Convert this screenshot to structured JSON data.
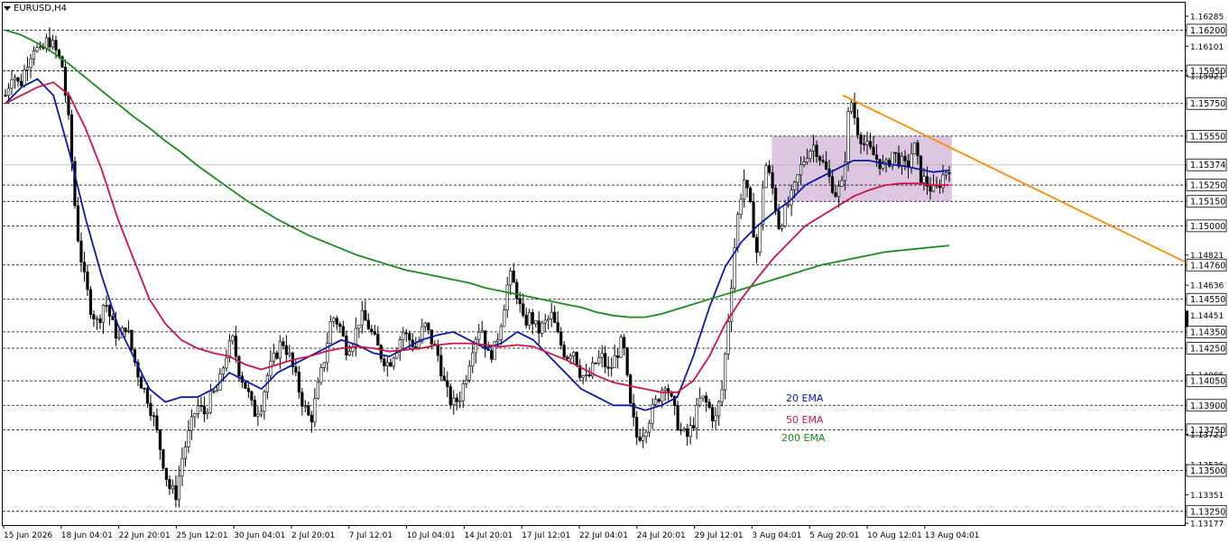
{
  "window": {
    "symbol_title": "EURUSD,H4"
  },
  "chart_data": {
    "type": "candlestick",
    "title": "EURUSD,H4",
    "ylim": [
      1.13177,
      1.16285
    ],
    "y_tick_labels": [
      "1.16285",
      "1.16200",
      "1.16101",
      "1.15950",
      "1.15921",
      "1.15750",
      "1.15550",
      "1.15374",
      "1.15250",
      "1.15150",
      "1.15000",
      "1.14821",
      "1.14760",
      "1.14636",
      "1.14550",
      "1.14451",
      "1.14350",
      "1.14250",
      "1.14086",
      "1.14050",
      "1.13900",
      "1.13750",
      "1.13721",
      "1.13536",
      "1.13500",
      "1.13351",
      "1.13250",
      "1.13177"
    ],
    "x_tick_labels": [
      "15 Jun 2026",
      "18 Jun 04:01",
      "22 Jun 20:01",
      "25 Jun 12:01",
      "30 Jun 04:01",
      "2 Jul 20:01",
      "7 Jul 12:01",
      "10 Jul 04:01",
      "14 Jul 20:01",
      "17 Jul 12:01",
      "22 Jul 04:01",
      "24 Jul 20:01",
      "29 Jul 12:01",
      "3 Aug 04:01",
      "5 Aug 20:01",
      "10 Aug 12:01",
      "13 Aug 04:01"
    ],
    "horizontal_levels": [
      1.162,
      1.1595,
      1.1575,
      1.1555,
      1.1525,
      1.1515,
      1.15,
      1.1476,
      1.1455,
      1.1435,
      1.1425,
      1.1405,
      1.139,
      1.1375,
      1.135,
      1.1325
    ],
    "current_price": 1.15374,
    "consolidation_zone": {
      "from": "3 Aug 04:01",
      "to": "13 Aug 04:01",
      "high": 1.1555,
      "low": 1.1515
    },
    "trendline": {
      "start": {
        "time": "5 Aug 20:01",
        "price": 1.158
      },
      "end": {
        "time": "beyond 13 Aug 04:01",
        "price": 1.1478
      }
    },
    "price_path": [
      1.158,
      1.1595,
      1.1585,
      1.16,
      1.161,
      1.1605,
      1.1615,
      1.1608,
      1.1598,
      1.156,
      1.15,
      1.147,
      1.145,
      1.144,
      1.1455,
      1.144,
      1.143,
      1.144,
      1.142,
      1.1405,
      1.1395,
      1.138,
      1.136,
      1.134,
      1.1335,
      1.136,
      1.1375,
      1.139,
      1.1385,
      1.1395,
      1.14,
      1.142,
      1.143,
      1.141,
      1.14,
      1.1385,
      1.139,
      1.141,
      1.142,
      1.143,
      1.142,
      1.1405,
      1.139,
      1.138,
      1.14,
      1.142,
      1.1445,
      1.144,
      1.1425,
      1.143,
      1.1445,
      1.144,
      1.143,
      1.142,
      1.1415,
      1.1425,
      1.1435,
      1.143,
      1.1425,
      1.144,
      1.143,
      1.142,
      1.14,
      1.139,
      1.1395,
      1.141,
      1.143,
      1.144,
      1.142,
      1.1425,
      1.1445,
      1.147,
      1.146,
      1.144,
      1.1445,
      1.1435,
      1.144,
      1.1445,
      1.143,
      1.142,
      1.1425,
      1.141,
      1.1405,
      1.1415,
      1.142,
      1.141,
      1.142,
      1.143,
      1.139,
      1.137,
      1.1375,
      1.1385,
      1.1395,
      1.1405,
      1.139,
      1.1375,
      1.137,
      1.138,
      1.1395,
      1.139,
      1.138,
      1.14,
      1.145,
      1.15,
      1.153,
      1.151,
      1.148,
      1.154,
      1.1525,
      1.15,
      1.151,
      1.152,
      1.1535,
      1.1545,
      1.155,
      1.154,
      1.153,
      1.152,
      1.1525,
      1.158,
      1.156,
      1.155,
      1.1545,
      1.154,
      1.1535,
      1.1545,
      1.154,
      1.1535,
      1.155,
      1.153,
      1.1525,
      1.152,
      1.153,
      1.1537
    ],
    "series": [
      {
        "name": "20 EMA",
        "color": "#0a18a8",
        "values": [
          1.1575,
          1.1585,
          1.159,
          1.158,
          1.1545,
          1.1505,
          1.147,
          1.144,
          1.142,
          1.14,
          1.1392,
          1.1395,
          1.1395,
          1.14,
          1.141,
          1.1405,
          1.14,
          1.141,
          1.1415,
          1.142,
          1.1425,
          1.143,
          1.1427,
          1.1422,
          1.142,
          1.1425,
          1.143,
          1.1433,
          1.1435,
          1.143,
          1.1425,
          1.1428,
          1.1435,
          1.143,
          1.142,
          1.141,
          1.14,
          1.1395,
          1.139,
          1.139,
          1.1387,
          1.139,
          1.1395,
          1.142,
          1.145,
          1.1475,
          1.149,
          1.15,
          1.1508,
          1.1515,
          1.1525,
          1.153,
          1.1535,
          1.154,
          1.154,
          1.1538,
          1.1537,
          1.1535,
          1.1533,
          1.1534
        ]
      },
      {
        "name": "50 EMA",
        "color": "#cc1445",
        "values": [
          1.1575,
          1.158,
          1.1585,
          1.1588,
          1.158,
          1.156,
          1.1535,
          1.1505,
          1.148,
          1.1455,
          1.144,
          1.143,
          1.1425,
          1.1422,
          1.142,
          1.1415,
          1.1412,
          1.1415,
          1.1418,
          1.142,
          1.1423,
          1.1425,
          1.1426,
          1.1425,
          1.1423,
          1.1424,
          1.1425,
          1.1427,
          1.1428,
          1.1428,
          1.1427,
          1.1426,
          1.1427,
          1.1426,
          1.1422,
          1.1418,
          1.1413,
          1.1408,
          1.1404,
          1.1402,
          1.14,
          1.1398,
          1.1398,
          1.1405,
          1.142,
          1.144,
          1.1455,
          1.1468,
          1.148,
          1.149,
          1.15,
          1.1506,
          1.1512,
          1.1518,
          1.1522,
          1.1525,
          1.1526,
          1.1526,
          1.1525,
          1.1525
        ]
      },
      {
        "name": "200 EMA",
        "color": "#1a8a1a",
        "values": [
          1.162,
          1.1617,
          1.1612,
          1.1606,
          1.1599,
          1.1591,
          1.1583,
          1.1575,
          1.1567,
          1.156,
          1.1552,
          1.1545,
          1.1537,
          1.153,
          1.1523,
          1.1516,
          1.151,
          1.1504,
          1.1499,
          1.1494,
          1.149,
          1.1486,
          1.1482,
          1.1479,
          1.1476,
          1.1473,
          1.1471,
          1.1469,
          1.1467,
          1.1465,
          1.1462,
          1.146,
          1.1458,
          1.1456,
          1.1454,
          1.1452,
          1.145,
          1.1447,
          1.1445,
          1.1444,
          1.1444,
          1.1446,
          1.1449,
          1.1452,
          1.1455,
          1.1458,
          1.1461,
          1.1464,
          1.1467,
          1.147,
          1.1473,
          1.1476,
          1.1478,
          1.148,
          1.1482,
          1.1484,
          1.1485,
          1.1486,
          1.1487,
          1.1488
        ]
      }
    ],
    "legend_labels": [
      "20 EMA",
      "50 EMA",
      "200 EMA"
    ]
  }
}
